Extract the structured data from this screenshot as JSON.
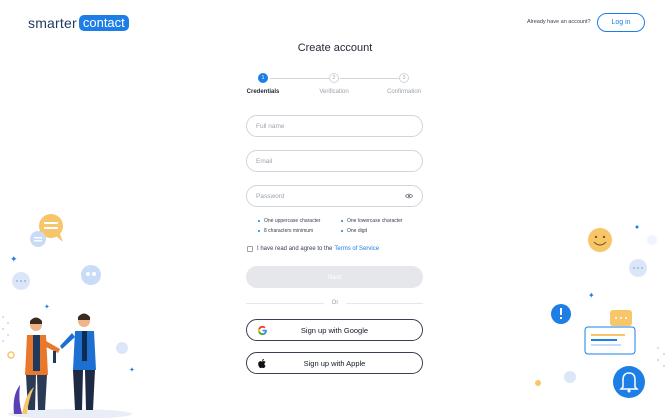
{
  "brand": {
    "name_part1": "smarter",
    "name_part2": "contact",
    "accent": "#1d7fe5"
  },
  "header": {
    "already_text": "Already have an account?",
    "login_label": "Log in"
  },
  "page": {
    "title": "Create account"
  },
  "steps": [
    {
      "number": "1",
      "label": "Credentials",
      "state": "active"
    },
    {
      "number": "2",
      "label": "Verification",
      "state": "todo"
    },
    {
      "number": "3",
      "label": "Confirmation",
      "state": "todo"
    }
  ],
  "form": {
    "full_name": {
      "placeholder": "Full name",
      "value": ""
    },
    "email": {
      "placeholder": "Email",
      "value": ""
    },
    "password": {
      "placeholder": "Password",
      "value": ""
    },
    "password_rules": [
      "One uppercase character",
      "One lowercase character",
      "8 characters minimum",
      "One digit"
    ],
    "agree_text": "I have read and agree to the",
    "terms_link": "Terms of Service",
    "agree_checked": false,
    "next_label": "Next",
    "or_text": "Or",
    "google_label": "Sign up with Google",
    "apple_label": "Sign up with Apple"
  },
  "icons": {
    "eye": "eye-icon",
    "google": "google-icon",
    "apple": "apple-icon"
  }
}
